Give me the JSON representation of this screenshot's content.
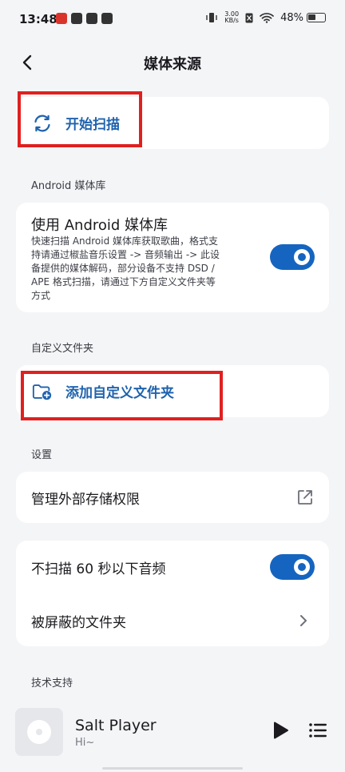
{
  "status_bar": {
    "time": "13:48",
    "net_speed_value": "3.00",
    "net_speed_unit": "KB/s",
    "battery": "48%"
  },
  "app_bar": {
    "title": "媒体来源"
  },
  "scan": {
    "label": "开始扫描"
  },
  "android_section": {
    "header": "Android 媒体库",
    "title": "使用 Android 媒体库",
    "description_lines": [
      "快速扫描 Android 媒体库获取歌曲，格式支",
      "持请通过椒盐音乐设置 -> 音频输出 -> 此设",
      "备提供的媒体解码，部分设备不支持 DSD /",
      "APE 格式扫描，请通过下方自定义文件夹等",
      "方式"
    ],
    "switch_on": true
  },
  "custom_section": {
    "header": "自定义文件夹",
    "add_label": "添加自定义文件夹"
  },
  "settings_section": {
    "header": "设置",
    "storage_permission": "管理外部存储权限",
    "skip_short": "不扫描 60 秒以下音频",
    "skip_short_on": true,
    "blocked_folders": "被屏蔽的文件夹"
  },
  "support_section": {
    "header": "技术支持"
  },
  "player": {
    "title": "Salt Player",
    "subtitle": "Hi~"
  },
  "colors": {
    "accent": "#1565c0",
    "link_text": "#1f63ae",
    "highlight_box": "#e02020",
    "background": "#f4f5f7"
  }
}
